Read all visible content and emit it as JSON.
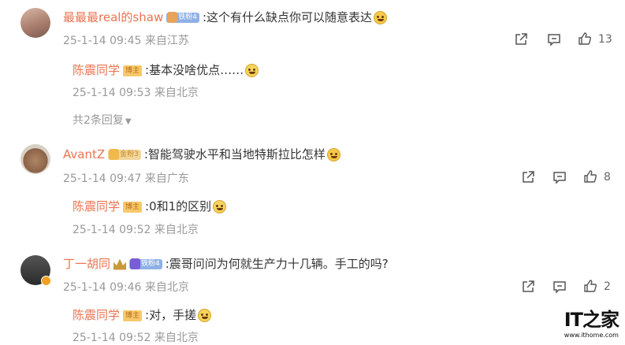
{
  "comments": [
    {
      "username": "最最最real的shaw",
      "fan_badge": "铁粉4",
      "text": ":这个有什么缺点你可以随意表达",
      "emoji": "cat-grin-emoji",
      "meta": "25-1-14 09:45 来自江苏",
      "likes": "13",
      "reply": {
        "username": "陈震同学",
        "badge": "博主",
        "text": ":基本没啥优点……",
        "emoji": "laugh-cry-emoji",
        "meta": "25-1-14 09:53 来自北京"
      },
      "more_replies": "共2条回复"
    },
    {
      "username": "AvantZ",
      "fan_badge": "金粉3",
      "text": ":智能驾驶水平和当地特斯拉比怎样",
      "emoji": "cat-grin-emoji",
      "meta": "25-1-14 09:47 来自广东",
      "likes": "8",
      "reply": {
        "username": "陈震同学",
        "badge": "博主",
        "text": ":0和1的区别",
        "emoji": "laugh-cry-emoji",
        "meta": "25-1-14 09:52 来自北京"
      }
    },
    {
      "username": "丁一胡同",
      "fan_badge": "铁粉4",
      "text": ":震哥问问为何就生产力十几辆。手工的吗?",
      "meta": "25-1-14 09:46 来自北京",
      "likes": "2",
      "reply": {
        "username": "陈震同学",
        "badge": "博主",
        "text": ":对，手搓",
        "emoji": "laugh-cry-emoji",
        "meta": "25-1-14 09:52 来自北京"
      }
    }
  ],
  "watermark": {
    "logo": "IT之家",
    "url": "www.ithome.com"
  },
  "colors": {
    "username": "#eb7350",
    "meta": "#999999",
    "text": "#333333"
  }
}
